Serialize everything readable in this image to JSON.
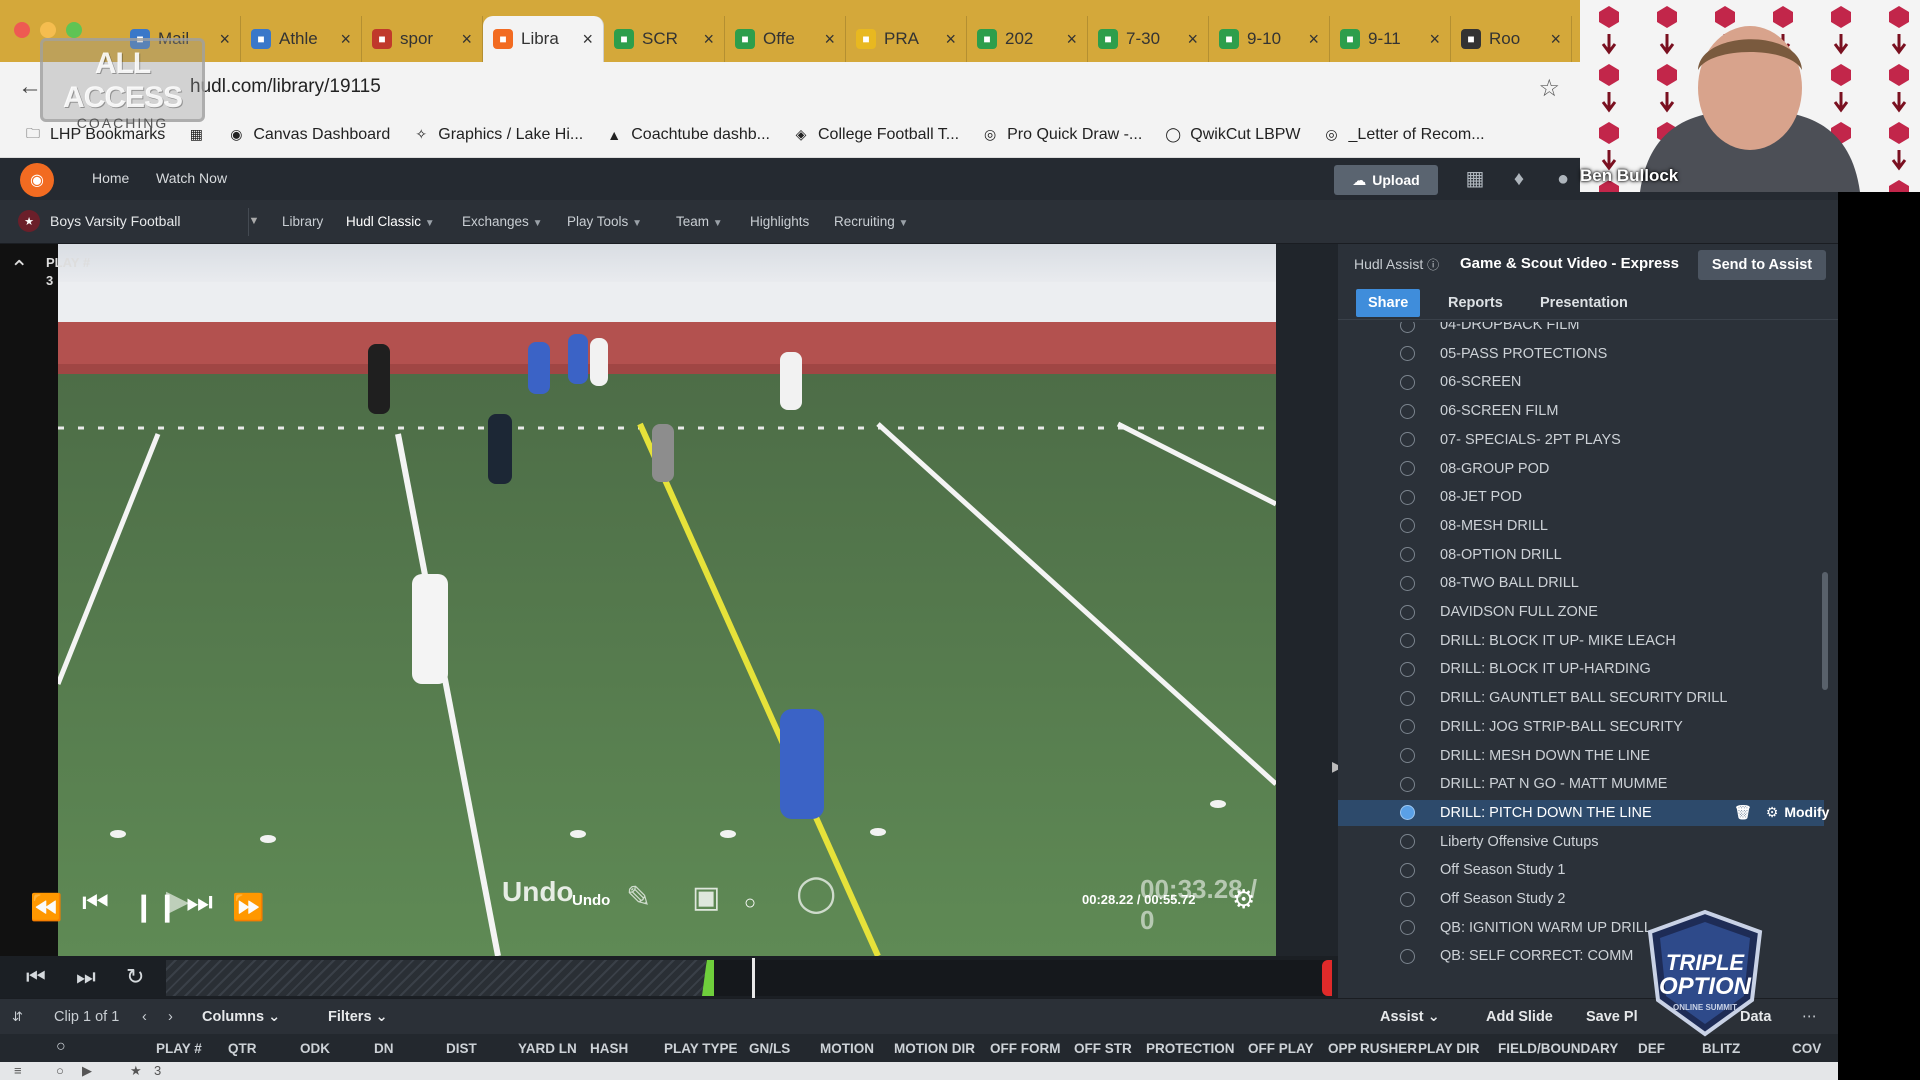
{
  "browser": {
    "tabs": [
      {
        "label": "Mail",
        "icon_color": "#3a78c9"
      },
      {
        "label": "Athle",
        "icon_color": "#3a78c9"
      },
      {
        "label": "spor",
        "icon_color": "#c0392b"
      },
      {
        "label": "Libra",
        "icon_color": "#f26b21",
        "active": true
      },
      {
        "label": "SCR",
        "icon_color": "#2d9e4b"
      },
      {
        "label": "Offe",
        "icon_color": "#2d9e4b"
      },
      {
        "label": "PRA",
        "icon_color": "#e8b820"
      },
      {
        "label": "202",
        "icon_color": "#2d9e4b"
      },
      {
        "label": "7-30",
        "icon_color": "#2d9e4b"
      },
      {
        "label": "9-10",
        "icon_color": "#2d9e4b"
      },
      {
        "label": "9-11",
        "icon_color": "#2d9e4b"
      },
      {
        "label": "Roo",
        "icon_color": "#333333"
      }
    ],
    "url": "hudl.com/library/19115",
    "bookmarks": [
      {
        "label": "LHP Bookmarks",
        "icon": "folder-icon"
      },
      {
        "label": "",
        "icon": "apps-grid-icon"
      },
      {
        "label": "Canvas Dashboard",
        "icon": "canvas-icon"
      },
      {
        "label": "Graphics / Lake Hi...",
        "icon": "graphics-icon"
      },
      {
        "label": "Coachtube dashb...",
        "icon": "coachtube-icon"
      },
      {
        "label": "College Football T...",
        "icon": "football-icon"
      },
      {
        "label": "Pro Quick Draw -...",
        "icon": "globe-icon"
      },
      {
        "label": "QwikCut LBPW",
        "icon": "qwikcut-icon"
      },
      {
        "label": "_Letter of Recom...",
        "icon": "globe-icon"
      }
    ]
  },
  "watermark": {
    "line1": "ALL ACCESS",
    "line2": "COACHING"
  },
  "hudl": {
    "nav": {
      "home": "Home",
      "watch_now": "Watch Now",
      "upload": "Upload",
      "user": "Ben Bullock"
    },
    "team": "Boys Varsity Football",
    "subnav": [
      "Library",
      "Hudl Classic",
      "Exchanges",
      "Play Tools",
      "Team",
      "Highlights",
      "Recruiting"
    ],
    "video": {
      "play_label": "PLAY #",
      "play_number": "3",
      "timecode": "00:28.22 / 00:55.72",
      "overlay_time": "00:33.28 / 0",
      "undo_big": "Undo",
      "undo_small": "Undo"
    },
    "assist_panel": {
      "assist_label": "Hudl Assist",
      "title": "Game & Scout Video - Express",
      "send_button": "Send to Assist",
      "tabs": [
        "Share",
        "Reports",
        "Presentation"
      ],
      "modify": "Modify",
      "playlists": [
        "04-DROPBACK FILM",
        "05-PASS PROTECTIONS",
        "06-SCREEN",
        "06-SCREEN FILM",
        "07- SPECIALS- 2PT PLAYS",
        "08-GROUP POD",
        "08-JET POD",
        "08-MESH DRILL",
        "08-OPTION DRILL",
        "08-TWO BALL DRILL",
        "DAVIDSON FULL ZONE",
        "DRILL: BLOCK IT UP- MIKE LEACH",
        "DRILL: BLOCK IT UP-HARDING",
        "DRILL: GAUNTLET BALL SECURITY DRILL",
        "DRILL: JOG STRIP-BALL SECURITY",
        "DRILL: MESH DOWN THE LINE",
        "DRILL: PAT N GO - MATT MUMME",
        "DRILL: PITCH DOWN THE LINE",
        "Liberty Offensive Cutups",
        "Off Season Study 1",
        "Off Season Study 2",
        "QB: IGNITION WARM UP DRILL",
        "QB: SELF CORRECT: COMM"
      ],
      "selected_index": 17
    },
    "toolbar": {
      "clip": "Clip 1 of 1",
      "columns": "Columns",
      "filters": "Filters",
      "assist": "Assist",
      "add_slide": "Add Slide",
      "save_playlist": "Save Pl",
      "export_data": "Data"
    },
    "columns": [
      "PLAY #",
      "QTR",
      "ODK",
      "DN",
      "DIST",
      "YARD LN",
      "HASH",
      "PLAY TYPE",
      "GN/LS",
      "MOTION",
      "MOTION DIR",
      "OFF FORM",
      "OFF STR",
      "PROTECTION",
      "OFF PLAY",
      "OPP RUSHER",
      "PLAY DIR",
      "FIELD/BOUNDARY",
      "DEF",
      "BLITZ",
      "COV"
    ],
    "row": {
      "play_number": "3"
    }
  },
  "overlay_badge": {
    "line1": "TRIPLE",
    "line2": "OPTION",
    "line3": "ONLINE SUMMIT"
  },
  "colors": {
    "accent": "#3f8ddb",
    "hudl_orange": "#f26b21",
    "tabbar": "#d4a83a"
  }
}
